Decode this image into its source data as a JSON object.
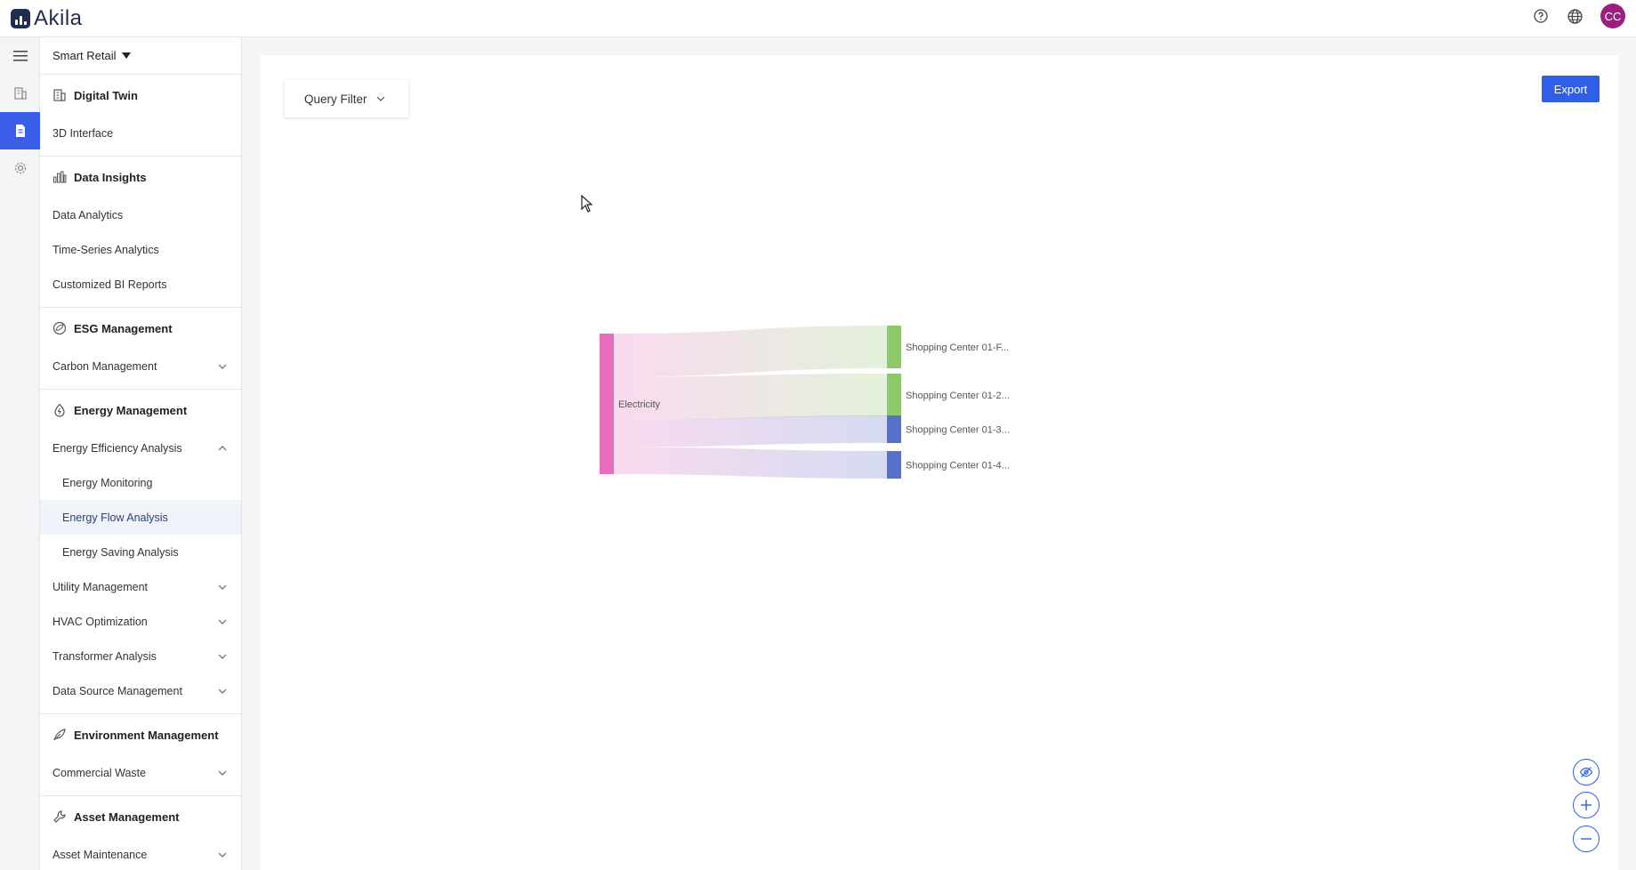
{
  "app": {
    "name": "Akila"
  },
  "header": {
    "avatar_initials": "CC"
  },
  "sidebar": {
    "project": "Smart Retail",
    "sections": [
      {
        "title": "Digital Twin",
        "icon": "building-icon",
        "items": [
          {
            "label": "3D Interface"
          }
        ]
      },
      {
        "title": "Data Insights",
        "icon": "bar-chart-icon",
        "items": [
          {
            "label": "Data Analytics"
          },
          {
            "label": "Time-Series Analytics"
          },
          {
            "label": "Customized BI Reports"
          }
        ]
      },
      {
        "title": "ESG Management",
        "icon": "globe-leaf-icon",
        "items": [
          {
            "label": "Carbon Management"
          }
        ]
      },
      {
        "title": "Energy Management",
        "icon": "drop-icon",
        "items": [
          {
            "label": "Energy Efficiency Analysis"
          },
          {
            "label": "Energy Monitoring"
          },
          {
            "label": "Energy Flow Analysis"
          },
          {
            "label": "Energy Saving Analysis"
          },
          {
            "label": "Utility Management"
          },
          {
            "label": "HVAC Optimization"
          },
          {
            "label": "Transformer Analysis"
          },
          {
            "label": "Data Source Management"
          }
        ]
      },
      {
        "title": "Environment Management",
        "icon": "leaf-icon",
        "items": [
          {
            "label": "Commercial Waste"
          }
        ]
      },
      {
        "title": "Asset Management",
        "icon": "wrench-icon",
        "items": [
          {
            "label": "Asset Maintenance"
          }
        ]
      }
    ]
  },
  "toolbar": {
    "query_filter_label": "Query Filter",
    "export_label": "Export"
  },
  "chart_data": {
    "type": "sankey",
    "nodes": [
      {
        "name": "Electricity",
        "color": "#e86dbf"
      },
      {
        "name": "Shopping Center 01-F...",
        "color": "#8dc96b"
      },
      {
        "name": "Shopping Center 01-2...",
        "color": "#8dc96b"
      },
      {
        "name": "Shopping Center 01-3...",
        "color": "#5770c8"
      },
      {
        "name": "Shopping Center 01-4...",
        "color": "#5770c8"
      }
    ],
    "links": [
      {
        "source": "Electricity",
        "target": "Shopping Center 01-F...",
        "value": 40
      },
      {
        "source": "Electricity",
        "target": "Shopping Center 01-2...",
        "value": 40
      },
      {
        "source": "Electricity",
        "target": "Shopping Center 01-3...",
        "value": 25
      },
      {
        "source": "Electricity",
        "target": "Shopping Center 01-4...",
        "value": 25
      }
    ]
  }
}
